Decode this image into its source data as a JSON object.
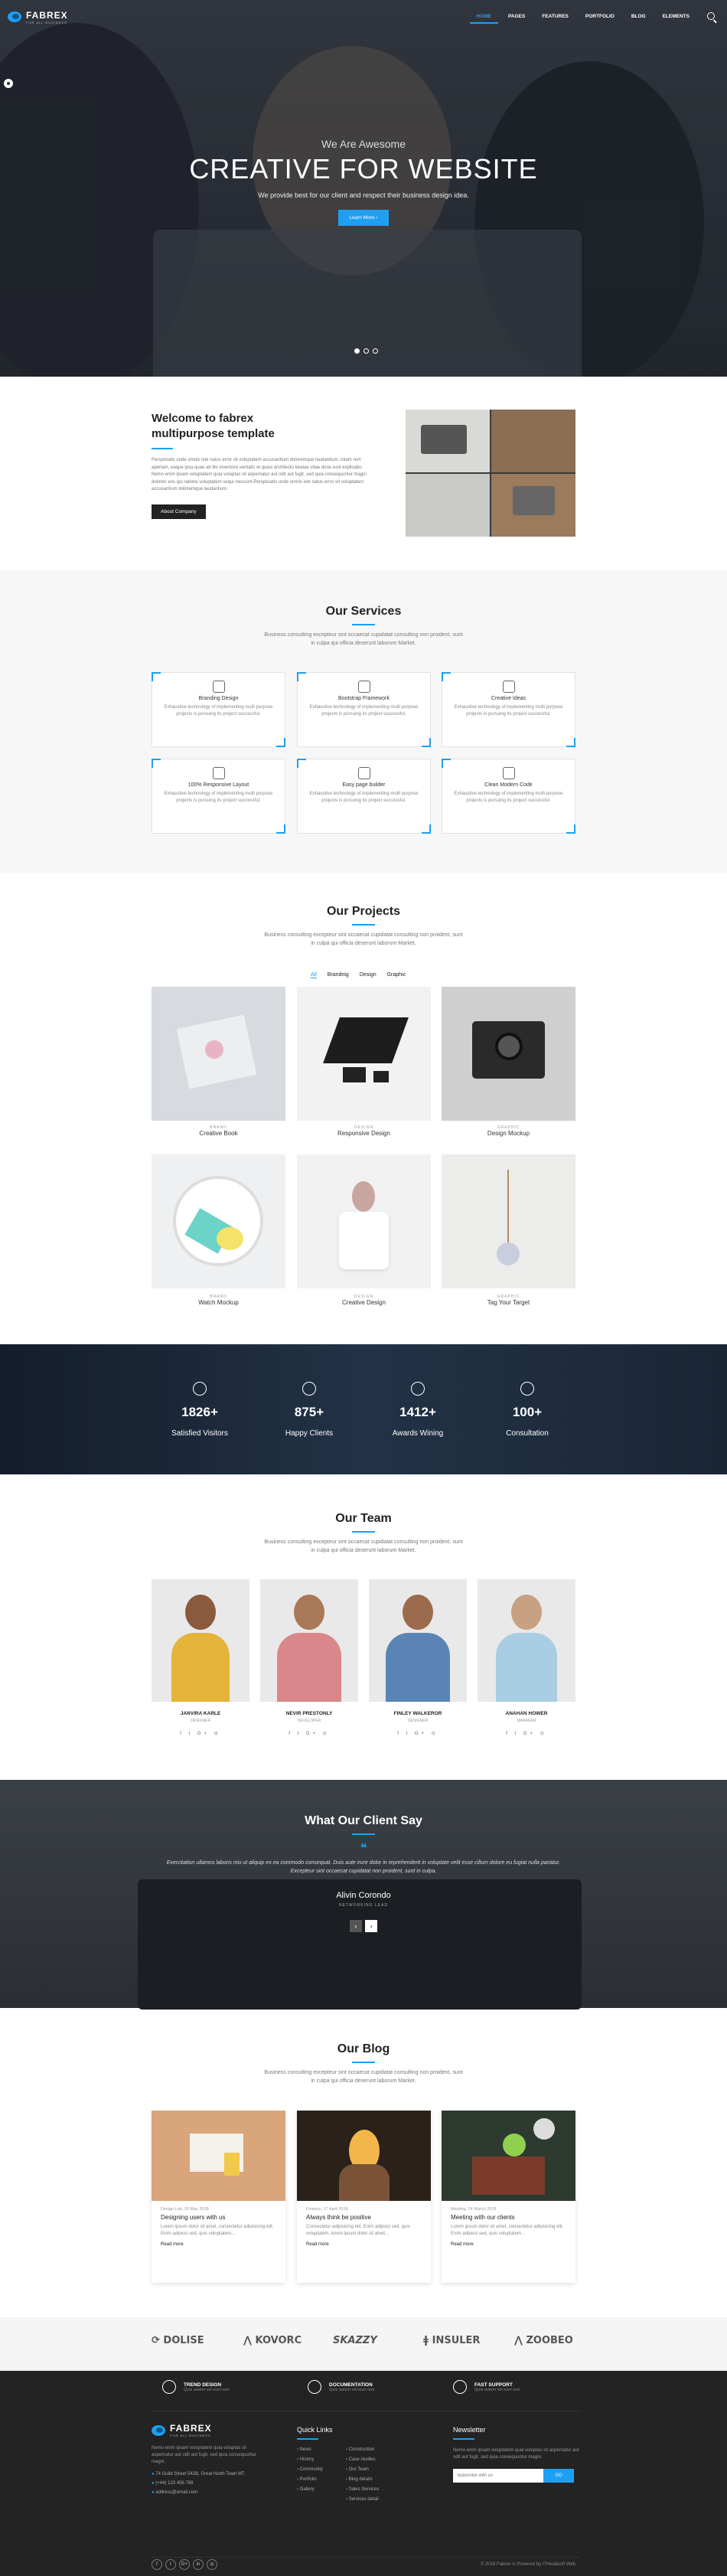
{
  "nav": {
    "logo": "FABREX",
    "logo_sub": "FOR ALL BUSINESS",
    "items": [
      "HOME",
      "PAGES",
      "FEATURES",
      "PORTFOLIO",
      "BLOG",
      "ELEMENTS"
    ]
  },
  "hero": {
    "kicker": "We Are Awesome",
    "title": "CREATIVE FOR WEBSITE",
    "subtitle": "We provide best for our client and respect their business design idea.",
    "button": "Learn More"
  },
  "welcome": {
    "title_line1": "Welcome to fabrex",
    "title_line2": "multipurpose template",
    "body": "Perspiciatis unde omnis iste natus error sit voluptatem accusantium doloremque laudantium, totam rem aperiam, eaque ipsa quae ab illo inventore veritatis et quasi architecto beatae vitae dicta sunt explicabo. Nemo enim ipsam voluptatem quia voluptas sit aspernatur aut odit aut fugit, sed quia consequuntur magni dolores eos qui ratione voluptatem sequi nesciunt.Perspiciatis unde omnis iste natus error sit voluptatem accusantium doloremque laudantium.",
    "button": "About Company"
  },
  "services": {
    "title": "Our Services",
    "subtitle_line1": "Business consulting excepteur sint occaecat cupidatat consulting non proident, sunt",
    "subtitle_line2": "in culpa qui officia deserunt laborum Market.",
    "items": [
      {
        "title": "Branding Design",
        "desc": "Exhaustive technology of implementing multi purpose projects is pursuing its project successful."
      },
      {
        "title": "Bootstrap Framework",
        "desc": "Exhaustive technology of implementing multi purpose projects is pursuing its project successful."
      },
      {
        "title": "Creative Ideas",
        "desc": "Exhaustive technology of implementing multi purpose projects is pursuing its project successful."
      },
      {
        "title": "100% Responsive Layout",
        "desc": "Exhaustive technology of implementing multi purpose projects is pursuing its project successful."
      },
      {
        "title": "Easy page builder",
        "desc": "Exhaustive technology of implementing multi purpose projects is pursuing its project successful."
      },
      {
        "title": "Clean Modern Code",
        "desc": "Exhaustive technology of implementing multi purpose projects is pursuing its project successful."
      }
    ]
  },
  "projects": {
    "title": "Our Projects",
    "subtitle_line1": "Business consulting excepteur sint occaecat cupidatat consulting non proident, sunt",
    "subtitle_line2": "in culpa qui officia deserunt laborum Market.",
    "filters": [
      "All",
      "Brandnig",
      "Design",
      "Graphic"
    ],
    "items": [
      {
        "cat": "BRAND",
        "name": "Creative Book"
      },
      {
        "cat": "DESIGN",
        "name": "Responsive Design"
      },
      {
        "cat": "GRAPHIC",
        "name": "Design Mockup"
      },
      {
        "cat": "BRAND",
        "name": "Watch Mockup"
      },
      {
        "cat": "DESIGN",
        "name": "Creative Design"
      },
      {
        "cat": "GRAPHIC",
        "name": "Tag Your Target"
      }
    ]
  },
  "counters": [
    {
      "num": "1826+",
      "label": "Satisfied Visitors"
    },
    {
      "num": "875+",
      "label": "Happy Clients"
    },
    {
      "num": "1412+",
      "label": "Awards Wining"
    },
    {
      "num": "100+",
      "label": "Consultation"
    }
  ],
  "team": {
    "title": "Our Team",
    "subtitle_line1": "Business consulting excepteur sint occaecat cupidatat consulting non proident, sunt",
    "subtitle_line2": "in culpa qui officia deserunt laborum Market.",
    "members": [
      {
        "name": "JANVIRA KARLE",
        "role": "DESIGNER"
      },
      {
        "name": "NEVIR PRESTONLY",
        "role": "DEVELOPER"
      },
      {
        "name": "FINLEY WALKEROR",
        "role": "DESIGNER"
      },
      {
        "name": "ANAHAN HOWER",
        "role": "MANAGER"
      }
    ],
    "social": "f  t  G+  ⊙"
  },
  "testimonial": {
    "title": "What Our Client Say",
    "quote": "Exercitation ullamco laboris nisi ut aliquip ex ea commodo consequat. Duis aute irure dolor in reprehenderit in voluptate velit esse cillum dolore eu fugiat nulla pariatur. Excepteur sint occaecat cupidatat non proident, sunt in culpa.",
    "name": "Alivin Corondo",
    "role": "NETWORKING LEAD"
  },
  "blog": {
    "title": "Our Blog",
    "subtitle_line1": "Business consulting excepteur sint occaecat cupidatat consulting non proident, sunt",
    "subtitle_line2": "in culpa qui officia deserunt laborum Market.",
    "posts": [
      {
        "meta": "Design Lab, 20 May 2018",
        "title": "Designing users with us",
        "excerpt": "Lorem ipsum dolor sit amet, consectetur adipisicing elit. Enim adipisci sed, quis voluptatem...",
        "more": "Read more"
      },
      {
        "meta": "Finance, 17 April 2018",
        "title": "Always think be positive",
        "excerpt": "Consectetur adipisicing elit. Enim adipisci sed, quis voluptatem, lorem ipsum dolor sit amet...",
        "more": "Read more"
      },
      {
        "meta": "Meeting, 24 March 2018",
        "title": "Meeting with our clients",
        "excerpt": "Lorem ipsum dolor sit amet, consectetur adipisicing elit. Enim adipisci sed, quis voluptatem...",
        "more": "Read more"
      }
    ]
  },
  "partners": [
    "DOLISE",
    "KOVORC",
    "SKAZZY",
    "INSULER",
    "ZOOBEO"
  ],
  "footer": {
    "features": [
      {
        "title": "TREND DESIGN",
        "desc": "Quis autem vel eum iure"
      },
      {
        "title": "DOCUMENTATION",
        "desc": "Quis autem vel eum iure"
      },
      {
        "title": "FAST SUPPORT",
        "desc": "Quis autem vel eum iure"
      }
    ],
    "logo": "FABREX",
    "logo_sub": "FOR ALL BUSINESS",
    "about": "Nemo enim ipsam voluptatem quia voluptas sit aspernatur aut odit aut fugit, sed quia consequuntur magni.",
    "address": "74 Guild Street 542B, Great North Town MT.",
    "phone": "(+44) 123 456 789",
    "email": "address@email.com",
    "quick_title": "Quick Links",
    "links_col1": [
      "News",
      "History",
      "Community",
      "Portfolio",
      "Gallery"
    ],
    "links_col2": [
      "Construction",
      "Case studies",
      "Our Team",
      "Blog details",
      "Sales Services",
      "Services detail"
    ],
    "newsletter_title": "Newsletter",
    "newsletter_desc": "Nemo enim ipsam voluptatem quia voluptas sit aspernatur aut odit aut fugit, sed quia consequuntur magni.",
    "newsletter_placeholder": "Subscribe with us",
    "newsletter_button": "GO",
    "social": [
      "f",
      "t",
      "G+",
      "in",
      "◎"
    ],
    "copyright": "© 2018 Fabrex is Powered by ITHeadsoft Web"
  },
  "colors": {
    "accent": "#1e9ff2",
    "dark": "#232323"
  }
}
